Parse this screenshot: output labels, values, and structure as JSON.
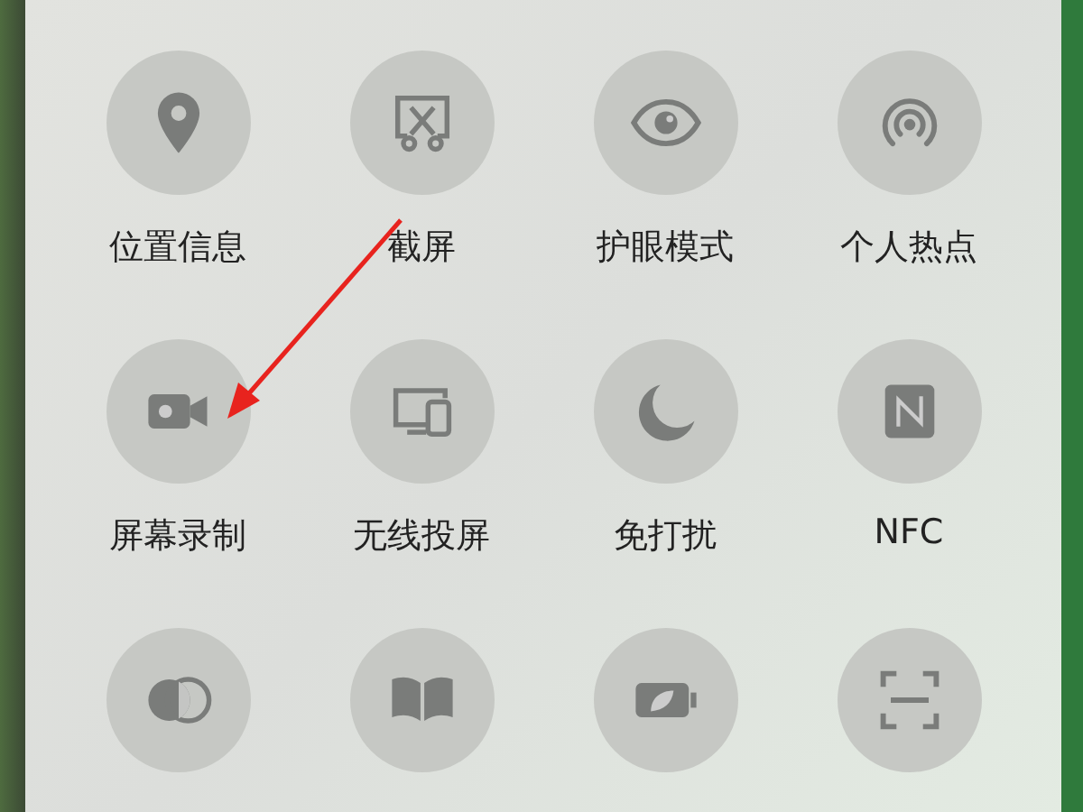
{
  "tiles": [
    {
      "kind": "location",
      "label": "位置信息"
    },
    {
      "kind": "screenshot",
      "label": "截屏"
    },
    {
      "kind": "eye",
      "label": "护眼模式"
    },
    {
      "kind": "hotspot",
      "label": "个人热点"
    },
    {
      "kind": "record",
      "label": "屏幕录制"
    },
    {
      "kind": "cast",
      "label": "无线投屏"
    },
    {
      "kind": "moon",
      "label": "免打扰"
    },
    {
      "kind": "nfc",
      "label": "NFC"
    },
    {
      "kind": "contrast"
    },
    {
      "kind": "book"
    },
    {
      "kind": "battery"
    },
    {
      "kind": "scan"
    }
  ]
}
